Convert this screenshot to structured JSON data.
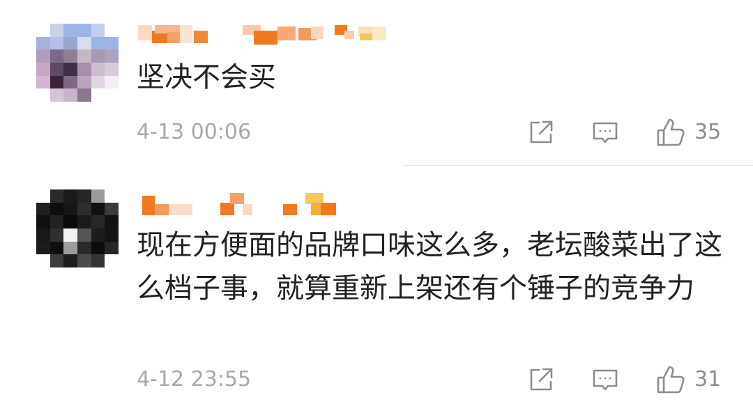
{
  "comments": [
    {
      "text": "坚决不会买",
      "time": "4-13 00:06",
      "likes": "35",
      "icons": {
        "share": "share-icon",
        "reply": "reply-icon",
        "like": "thumbs-up-icon"
      }
    },
    {
      "text": "现在方便面的品牌口味这么多，老坛酸菜出了这么档子事，就算重新上架还有个锤子的竞争力",
      "time": "4-12 23:55",
      "likes": "31",
      "icons": {
        "share": "share-icon",
        "reply": "reply-icon",
        "like": "thumbs-up-icon"
      }
    }
  ],
  "colors": {
    "accent_orange": "#f07a22",
    "text": "#222222",
    "muted": "#a8a8a8"
  }
}
